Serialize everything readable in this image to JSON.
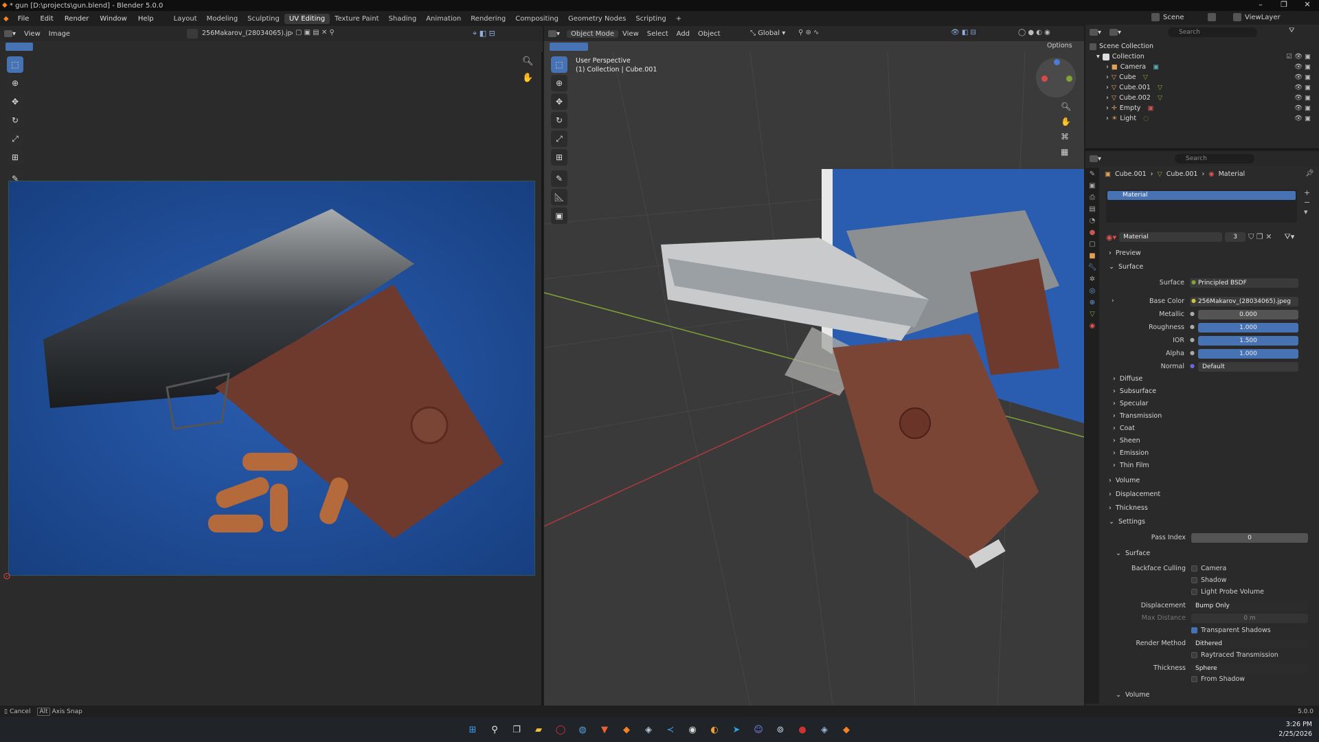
{
  "window": {
    "title": "* gun [D:\\projects\\gun.blend] - Blender 5.0.0"
  },
  "menu": [
    "File",
    "Edit",
    "Render",
    "Window",
    "Help"
  ],
  "workspaces": [
    "Layout",
    "Modeling",
    "Sculpting",
    "UV Editing",
    "Texture Paint",
    "Shading",
    "Animation",
    "Rendering",
    "Compositing",
    "Geometry Nodes",
    "Scripting"
  ],
  "active_workspace": "UV Editing",
  "scene": {
    "name": "Scene",
    "view_layer": "ViewLayer"
  },
  "uv_editor": {
    "menus": [
      "View",
      "Image"
    ],
    "image_name": "256Makarov_(28034065).jpeg"
  },
  "viewport": {
    "mode": "Object Mode",
    "menus": [
      "View",
      "Select",
      "Add",
      "Object"
    ],
    "transform": "Global",
    "options": "Options",
    "overlay_title": "User Perspective",
    "overlay_sub": "(1) Collection | Cube.001"
  },
  "outliner": {
    "search_placeholder": "Search",
    "root": "Scene Collection",
    "collection": "Collection",
    "items": [
      "Camera",
      "Cube",
      "Cube.001",
      "Cube.002",
      "Empty",
      "Light"
    ]
  },
  "properties": {
    "search_placeholder": "Search",
    "breadcrumb": [
      "Cube.001",
      "Cube.001",
      "Material"
    ],
    "slot": "Material",
    "material_name": "Material",
    "users": "3",
    "panels": {
      "preview": "Preview",
      "surface": "Surface"
    },
    "surface_label": "Surface",
    "surface_value": "Principled BSDF",
    "base_color_label": "Base Color",
    "base_color_value": "256Makarov_(28034065).jpeg",
    "metallic_label": "Metallic",
    "metallic_value": "0.000",
    "metallic": 0.0,
    "roughness_label": "Roughness",
    "roughness_value": "1.000",
    "roughness": 1.0,
    "ior_label": "IOR",
    "ior_value": "1.500",
    "alpha_label": "Alpha",
    "alpha_value": "1.000",
    "alpha": 1.0,
    "normal_label": "Normal",
    "normal_value": "Default",
    "subpanels": [
      "Diffuse",
      "Subsurface",
      "Specular",
      "Transmission",
      "Coat",
      "Sheen",
      "Emission",
      "Thin Film"
    ],
    "panels2": [
      "Volume",
      "Displacement",
      "Thickness"
    ],
    "settings": "Settings",
    "pass_index_label": "Pass Index",
    "pass_index": "0",
    "settings_surface": "Surface",
    "backface_culling": "Backface Culling",
    "bc_options": [
      "Camera",
      "Shadow",
      "Light Probe Volume"
    ],
    "displacement_label": "Displacement",
    "displacement_value": "Bump Only",
    "max_distance_label": "Max Distance",
    "max_distance": "0 m",
    "transparent_shadows": "Transparent Shadows",
    "render_method_label": "Render Method",
    "render_method": "Dithered",
    "raytraced_transmission": "Raytraced Transmission",
    "thickness_label": "Thickness",
    "thickness_value": "Sphere",
    "from_shadow": "From Shadow",
    "volume": "Volume"
  },
  "status": {
    "cancel": "Cancel",
    "axis_snap": "Axis Snap",
    "alt": "Alt",
    "version": "5.0.0"
  },
  "taskbar": {
    "time": "3:26 PM",
    "date": "2/25/2026"
  },
  "colors": {
    "accent": "#4772b3",
    "header": "#282828",
    "panel": "#2a2a2a",
    "x_axis": "#b0393f",
    "y_axis": "#7ea536"
  }
}
